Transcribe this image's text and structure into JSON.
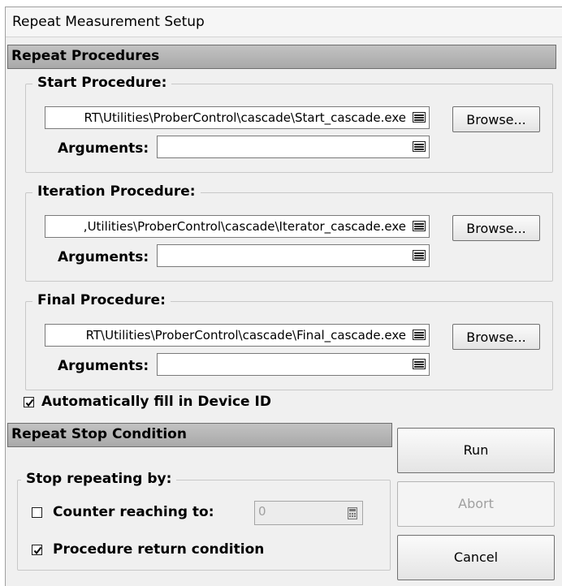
{
  "window": {
    "title": "Repeat Measurement Setup"
  },
  "repeat_procedures": {
    "header": "Repeat Procedures",
    "start": {
      "label": "Start Procedure:",
      "path": "RT\\Utilities\\ProberControl\\cascade\\Start_cascade.exe",
      "arguments_label": "Arguments:",
      "arguments_value": "",
      "browse_label": "Browse..."
    },
    "iteration": {
      "label": "Iteration Procedure:",
      "path": ",Utilities\\ProberControl\\cascade\\Iterator_cascade.exe",
      "arguments_label": "Arguments:",
      "arguments_value": "",
      "browse_label": "Browse..."
    },
    "final": {
      "label": "Final Procedure:",
      "path": "RT\\Utilities\\ProberControl\\cascade\\Final_cascade.exe",
      "arguments_label": "Arguments:",
      "arguments_value": "",
      "browse_label": "Browse..."
    },
    "auto_fill": {
      "label": "Automatically fill in Device ID",
      "checked": true
    }
  },
  "stop_condition": {
    "header": "Repeat Stop Condition",
    "group_label": "Stop repeating by:",
    "counter": {
      "label": "Counter reaching to:",
      "checked": false,
      "value": "0"
    },
    "procedure_return": {
      "label": "Procedure return condition",
      "checked": true
    }
  },
  "buttons": {
    "run": "Run",
    "abort": "Abort",
    "cancel": "Cancel"
  },
  "colors": {
    "header_bg": "#a9a9a9",
    "window_bg": "#f0f0f0",
    "disabled_text": "#a0a0a0"
  }
}
